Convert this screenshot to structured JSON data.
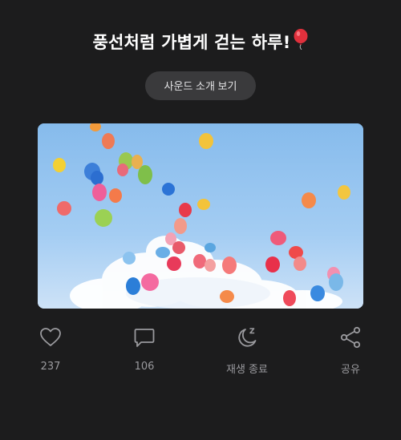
{
  "post": {
    "title": "풍선처럼 가볍게 걷는 하루!",
    "title_emoji": "balloon-emoji",
    "sound_button_label": "사운드 소개 보기"
  },
  "hero_image": {
    "alt": "파란 하늘과 구름 위로 떠오르는 알록달록한 하트 풍선들"
  },
  "actions": {
    "like": {
      "icon": "heart-icon",
      "label": "237"
    },
    "comment": {
      "icon": "comment-icon",
      "label": "106"
    },
    "sleep": {
      "icon": "moon-sleep-icon",
      "label": "재생 종료"
    },
    "share": {
      "icon": "share-icon",
      "label": "공유"
    }
  },
  "colors": {
    "background": "#1c1c1d",
    "button_bg": "#3a3a3c",
    "icon_gray": "#9a9a9e",
    "title": "#ffffff"
  }
}
